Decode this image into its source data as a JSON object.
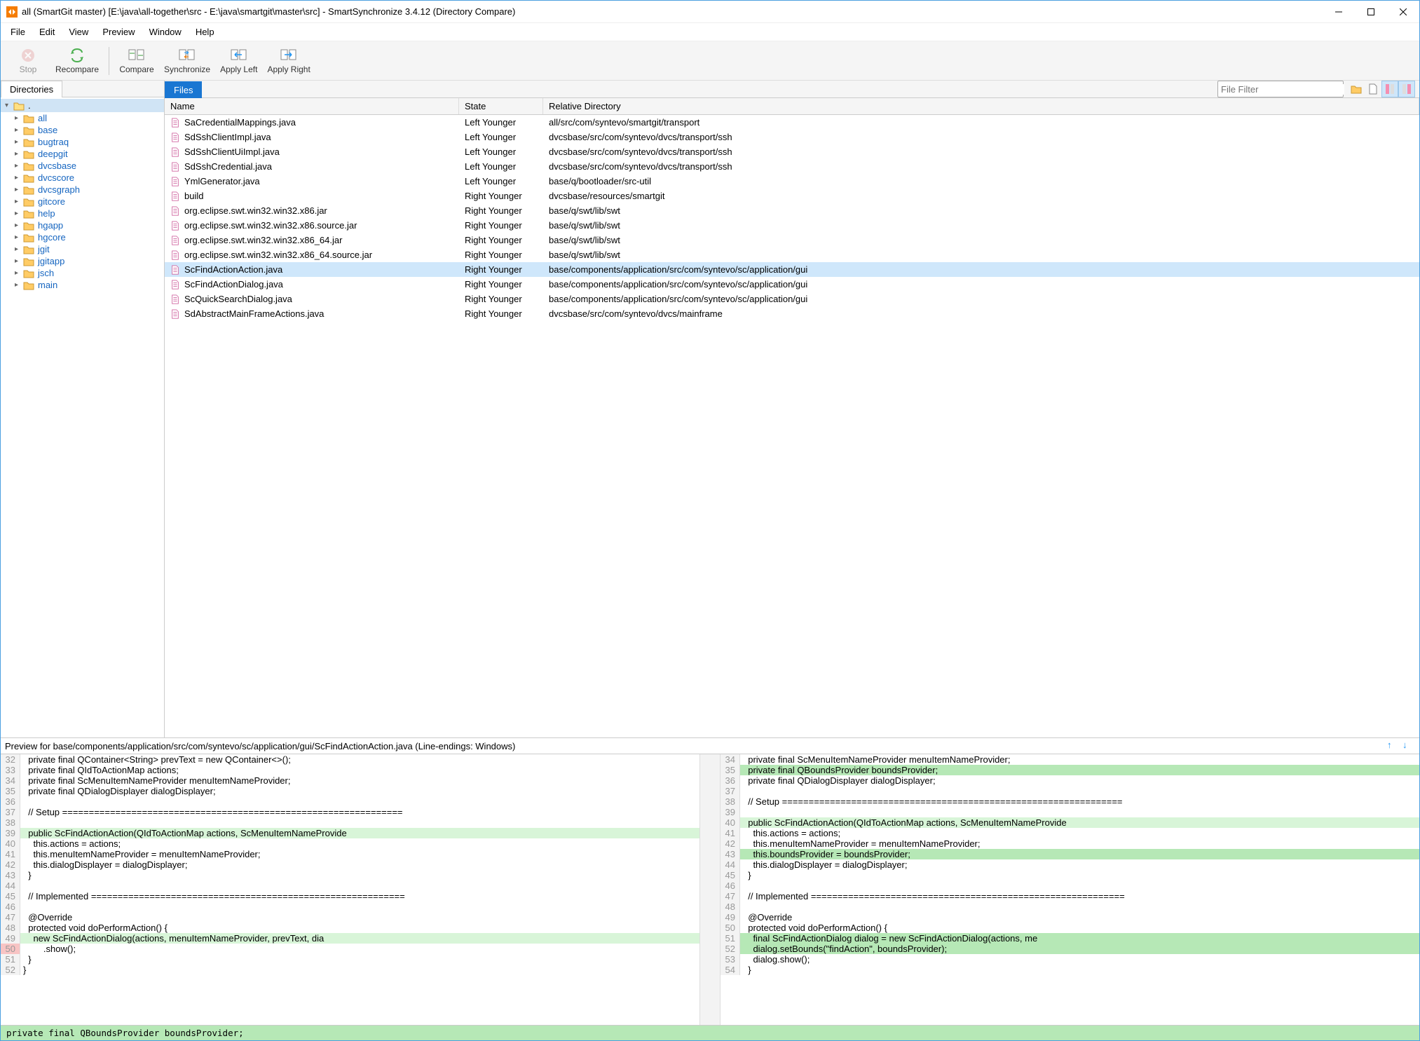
{
  "window": {
    "title": "all (SmartGit master) [E:\\java\\all-together\\src - E:\\java\\smartgit\\master\\src] - SmartSynchronize 3.4.12 (Directory Compare)"
  },
  "menu": {
    "items": [
      "File",
      "Edit",
      "View",
      "Preview",
      "Window",
      "Help"
    ]
  },
  "toolbar": {
    "stop": "Stop",
    "recompare": "Recompare",
    "compare": "Compare",
    "synchronize": "Synchronize",
    "apply_left": "Apply Left",
    "apply_right": "Apply Right"
  },
  "panels": {
    "directories_tab": "Directories",
    "files_tab": "Files",
    "filter_placeholder": "File Filter"
  },
  "tree": {
    "root": ".",
    "items": [
      "all",
      "base",
      "bugtraq",
      "deepgit",
      "dvcsbase",
      "dvcscore",
      "dvcsgraph",
      "gitcore",
      "help",
      "hgapp",
      "hgcore",
      "jgit",
      "jgitapp",
      "jsch",
      "main"
    ]
  },
  "file_table": {
    "headers": {
      "name": "Name",
      "state": "State",
      "dir": "Relative Directory"
    },
    "rows": [
      {
        "name": "SaCredentialMappings.java",
        "state": "Left Younger",
        "dir": "all/src/com/syntevo/smartgit/transport"
      },
      {
        "name": "SdSshClientImpl.java",
        "state": "Left Younger",
        "dir": "dvcsbase/src/com/syntevo/dvcs/transport/ssh"
      },
      {
        "name": "SdSshClientUiImpl.java",
        "state": "Left Younger",
        "dir": "dvcsbase/src/com/syntevo/dvcs/transport/ssh"
      },
      {
        "name": "SdSshCredential.java",
        "state": "Left Younger",
        "dir": "dvcsbase/src/com/syntevo/dvcs/transport/ssh"
      },
      {
        "name": "YmlGenerator.java",
        "state": "Left Younger",
        "dir": "base/q/bootloader/src-util"
      },
      {
        "name": "build",
        "state": "Right Younger",
        "dir": "dvcsbase/resources/smartgit"
      },
      {
        "name": "org.eclipse.swt.win32.win32.x86.jar",
        "state": "Right Younger",
        "dir": "base/q/swt/lib/swt"
      },
      {
        "name": "org.eclipse.swt.win32.win32.x86.source.jar",
        "state": "Right Younger",
        "dir": "base/q/swt/lib/swt"
      },
      {
        "name": "org.eclipse.swt.win32.win32.x86_64.jar",
        "state": "Right Younger",
        "dir": "base/q/swt/lib/swt"
      },
      {
        "name": "org.eclipse.swt.win32.win32.x86_64.source.jar",
        "state": "Right Younger",
        "dir": "base/q/swt/lib/swt"
      },
      {
        "name": "ScFindActionAction.java",
        "state": "Right Younger",
        "dir": "base/components/application/src/com/syntevo/sc/application/gui",
        "selected": true
      },
      {
        "name": "ScFindActionDialog.java",
        "state": "Right Younger",
        "dir": "base/components/application/src/com/syntevo/sc/application/gui"
      },
      {
        "name": "ScQuickSearchDialog.java",
        "state": "Right Younger",
        "dir": "base/components/application/src/com/syntevo/sc/application/gui"
      },
      {
        "name": "SdAbstractMainFrameActions.java",
        "state": "Right Younger",
        "dir": "dvcsbase/src/com/syntevo/dvcs/mainframe"
      }
    ]
  },
  "preview": {
    "title": "Preview for base/components/application/src/com/syntevo/sc/application/gui/ScFindActionAction.java (Line-endings: Windows)",
    "left": [
      {
        "n": 32,
        "t": "  private final QContainer<String> prevText = new QContainer<>();"
      },
      {
        "n": 33,
        "t": "  private final QIdToActionMap actions;"
      },
      {
        "n": 34,
        "t": "  private final ScMenuItemNameProvider menuItemNameProvider;"
      },
      {
        "n": 35,
        "t": "  private final QDialogDisplayer dialogDisplayer;"
      },
      {
        "n": 36,
        "t": ""
      },
      {
        "n": 37,
        "t": "  // Setup ================================================================"
      },
      {
        "n": 38,
        "t": ""
      },
      {
        "n": 39,
        "t": "  public ScFindActionAction(QIdToActionMap actions, ScMenuItemNameProvide",
        "cls": "green-light"
      },
      {
        "n": 40,
        "t": "    this.actions = actions;"
      },
      {
        "n": 41,
        "t": "    this.menuItemNameProvider = menuItemNameProvider;"
      },
      {
        "n": 42,
        "t": "    this.dialogDisplayer = dialogDisplayer;"
      },
      {
        "n": 43,
        "t": "  }"
      },
      {
        "n": 44,
        "t": ""
      },
      {
        "n": 45,
        "t": "  // Implemented ==========================================================="
      },
      {
        "n": 46,
        "t": ""
      },
      {
        "n": 47,
        "t": "  @Override"
      },
      {
        "n": 48,
        "t": "  protected void doPerformAction() {"
      },
      {
        "n": 49,
        "t": "    new ScFindActionDialog(actions, menuItemNameProvider, prevText, dia",
        "cls": "green-light"
      },
      {
        "n": 50,
        "t": "        .show();",
        "cls": "red-gutter"
      },
      {
        "n": 51,
        "t": "  }"
      },
      {
        "n": 52,
        "t": "}"
      }
    ],
    "right": [
      {
        "n": 34,
        "t": "  private final ScMenuItemNameProvider menuItemNameProvider;"
      },
      {
        "n": 35,
        "t": "  private final QBoundsProvider boundsProvider;",
        "cls": "green"
      },
      {
        "n": 36,
        "t": "  private final QDialogDisplayer dialogDisplayer;"
      },
      {
        "n": 37,
        "t": ""
      },
      {
        "n": 38,
        "t": "  // Setup ================================================================"
      },
      {
        "n": 39,
        "t": ""
      },
      {
        "n": 40,
        "t": "  public ScFindActionAction(QIdToActionMap actions, ScMenuItemNameProvide",
        "cls": "green-light"
      },
      {
        "n": 41,
        "t": "    this.actions = actions;"
      },
      {
        "n": 42,
        "t": "    this.menuItemNameProvider = menuItemNameProvider;"
      },
      {
        "n": 43,
        "t": "    this.boundsProvider = boundsProvider;",
        "cls": "green"
      },
      {
        "n": 44,
        "t": "    this.dialogDisplayer = dialogDisplayer;"
      },
      {
        "n": 45,
        "t": "  }"
      },
      {
        "n": 46,
        "t": ""
      },
      {
        "n": 47,
        "t": "  // Implemented ==========================================================="
      },
      {
        "n": 48,
        "t": ""
      },
      {
        "n": 49,
        "t": "  @Override"
      },
      {
        "n": 50,
        "t": "  protected void doPerformAction() {"
      },
      {
        "n": 51,
        "t": "    final ScFindActionDialog dialog = new ScFindActionDialog(actions, me",
        "cls": "green"
      },
      {
        "n": 52,
        "t": "    dialog.setBounds(\"findAction\", boundsProvider);",
        "cls": "green"
      },
      {
        "n": 53,
        "t": "    dialog.show();"
      },
      {
        "n": 54,
        "t": "  }"
      }
    ]
  },
  "status": "  private final QBoundsProvider boundsProvider;"
}
